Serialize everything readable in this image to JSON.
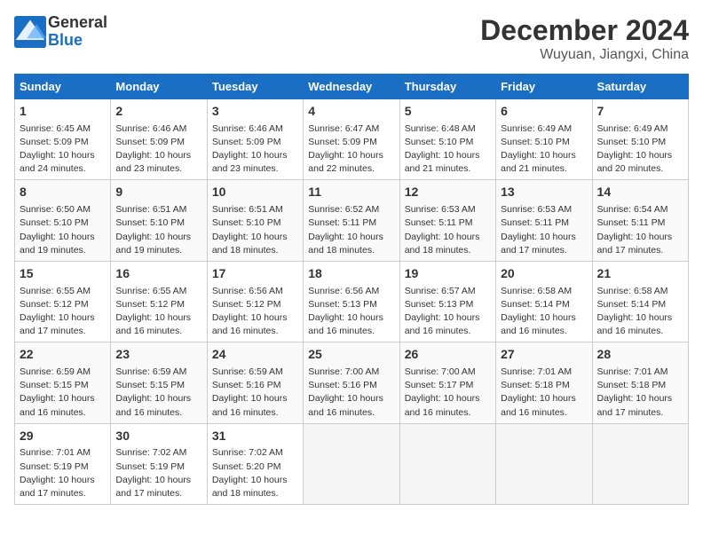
{
  "header": {
    "logo_line1": "General",
    "logo_line2": "Blue",
    "month_title": "December 2024",
    "location": "Wuyuan, Jiangxi, China"
  },
  "weekdays": [
    "Sunday",
    "Monday",
    "Tuesday",
    "Wednesday",
    "Thursday",
    "Friday",
    "Saturday"
  ],
  "weeks": [
    [
      {
        "day": 1,
        "sunrise": "6:45 AM",
        "sunset": "5:09 PM",
        "daylight": "10 hours and 24 minutes."
      },
      {
        "day": 2,
        "sunrise": "6:46 AM",
        "sunset": "5:09 PM",
        "daylight": "10 hours and 23 minutes."
      },
      {
        "day": 3,
        "sunrise": "6:46 AM",
        "sunset": "5:09 PM",
        "daylight": "10 hours and 23 minutes."
      },
      {
        "day": 4,
        "sunrise": "6:47 AM",
        "sunset": "5:09 PM",
        "daylight": "10 hours and 22 minutes."
      },
      {
        "day": 5,
        "sunrise": "6:48 AM",
        "sunset": "5:10 PM",
        "daylight": "10 hours and 21 minutes."
      },
      {
        "day": 6,
        "sunrise": "6:49 AM",
        "sunset": "5:10 PM",
        "daylight": "10 hours and 21 minutes."
      },
      {
        "day": 7,
        "sunrise": "6:49 AM",
        "sunset": "5:10 PM",
        "daylight": "10 hours and 20 minutes."
      }
    ],
    [
      {
        "day": 8,
        "sunrise": "6:50 AM",
        "sunset": "5:10 PM",
        "daylight": "10 hours and 19 minutes."
      },
      {
        "day": 9,
        "sunrise": "6:51 AM",
        "sunset": "5:10 PM",
        "daylight": "10 hours and 19 minutes."
      },
      {
        "day": 10,
        "sunrise": "6:51 AM",
        "sunset": "5:10 PM",
        "daylight": "10 hours and 18 minutes."
      },
      {
        "day": 11,
        "sunrise": "6:52 AM",
        "sunset": "5:11 PM",
        "daylight": "10 hours and 18 minutes."
      },
      {
        "day": 12,
        "sunrise": "6:53 AM",
        "sunset": "5:11 PM",
        "daylight": "10 hours and 18 minutes."
      },
      {
        "day": 13,
        "sunrise": "6:53 AM",
        "sunset": "5:11 PM",
        "daylight": "10 hours and 17 minutes."
      },
      {
        "day": 14,
        "sunrise": "6:54 AM",
        "sunset": "5:11 PM",
        "daylight": "10 hours and 17 minutes."
      }
    ],
    [
      {
        "day": 15,
        "sunrise": "6:55 AM",
        "sunset": "5:12 PM",
        "daylight": "10 hours and 17 minutes."
      },
      {
        "day": 16,
        "sunrise": "6:55 AM",
        "sunset": "5:12 PM",
        "daylight": "10 hours and 16 minutes."
      },
      {
        "day": 17,
        "sunrise": "6:56 AM",
        "sunset": "5:12 PM",
        "daylight": "10 hours and 16 minutes."
      },
      {
        "day": 18,
        "sunrise": "6:56 AM",
        "sunset": "5:13 PM",
        "daylight": "10 hours and 16 minutes."
      },
      {
        "day": 19,
        "sunrise": "6:57 AM",
        "sunset": "5:13 PM",
        "daylight": "10 hours and 16 minutes."
      },
      {
        "day": 20,
        "sunrise": "6:58 AM",
        "sunset": "5:14 PM",
        "daylight": "10 hours and 16 minutes."
      },
      {
        "day": 21,
        "sunrise": "6:58 AM",
        "sunset": "5:14 PM",
        "daylight": "10 hours and 16 minutes."
      }
    ],
    [
      {
        "day": 22,
        "sunrise": "6:59 AM",
        "sunset": "5:15 PM",
        "daylight": "10 hours and 16 minutes."
      },
      {
        "day": 23,
        "sunrise": "6:59 AM",
        "sunset": "5:15 PM",
        "daylight": "10 hours and 16 minutes."
      },
      {
        "day": 24,
        "sunrise": "6:59 AM",
        "sunset": "5:16 PM",
        "daylight": "10 hours and 16 minutes."
      },
      {
        "day": 25,
        "sunrise": "7:00 AM",
        "sunset": "5:16 PM",
        "daylight": "10 hours and 16 minutes."
      },
      {
        "day": 26,
        "sunrise": "7:00 AM",
        "sunset": "5:17 PM",
        "daylight": "10 hours and 16 minutes."
      },
      {
        "day": 27,
        "sunrise": "7:01 AM",
        "sunset": "5:18 PM",
        "daylight": "10 hours and 16 minutes."
      },
      {
        "day": 28,
        "sunrise": "7:01 AM",
        "sunset": "5:18 PM",
        "daylight": "10 hours and 17 minutes."
      }
    ],
    [
      {
        "day": 29,
        "sunrise": "7:01 AM",
        "sunset": "5:19 PM",
        "daylight": "10 hours and 17 minutes."
      },
      {
        "day": 30,
        "sunrise": "7:02 AM",
        "sunset": "5:19 PM",
        "daylight": "10 hours and 17 minutes."
      },
      {
        "day": 31,
        "sunrise": "7:02 AM",
        "sunset": "5:20 PM",
        "daylight": "10 hours and 18 minutes."
      },
      null,
      null,
      null,
      null
    ]
  ],
  "labels": {
    "sunrise": "Sunrise:",
    "sunset": "Sunset:",
    "daylight": "Daylight:"
  }
}
